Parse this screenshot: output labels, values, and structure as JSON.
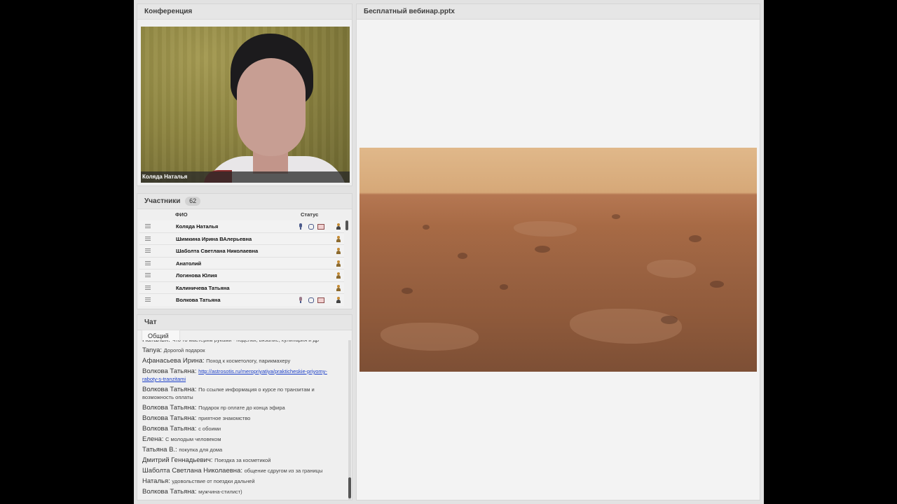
{
  "conference": {
    "title": "Конференция",
    "speaker_name": "Коляда Наталья"
  },
  "participants": {
    "title": "Участники",
    "count": "62",
    "col_name": "ФИО",
    "col_status": "Статус",
    "rows": [
      {
        "name": "Коляда Наталья",
        "mic": true,
        "mic_off": false,
        "cam": true,
        "screen": true,
        "role": "dark"
      },
      {
        "name": "Шимкина Ирина  ВАлерьевна",
        "mic": false,
        "cam": false,
        "screen": false,
        "role": "light"
      },
      {
        "name": "Шаболта Светлана  Николаевна",
        "mic": false,
        "cam": false,
        "screen": false,
        "role": "light"
      },
      {
        "name": "Анатолий",
        "mic": false,
        "cam": false,
        "screen": false,
        "role": "light"
      },
      {
        "name": "Логинова Юлия",
        "mic": false,
        "cam": false,
        "screen": false,
        "role": "light"
      },
      {
        "name": "Калиничева Татьяна",
        "mic": false,
        "cam": false,
        "screen": false,
        "role": "light"
      },
      {
        "name": "Волкова Татьяна",
        "mic": true,
        "mic_off": true,
        "cam": true,
        "screen": true,
        "role": "dark"
      }
    ]
  },
  "chat": {
    "title": "Чат",
    "tab": "Общий",
    "messages": [
      {
        "author": "Наталья:",
        "text": "Что то мастерим руками - поделки, вязание, кулинария и др",
        "link": ""
      },
      {
        "author": "Tanya:",
        "text": "Дорогой подарок",
        "link": ""
      },
      {
        "author": "Афанасьева Ирина:",
        "text": "Поход к косметологу, парикмахеру",
        "link": ""
      },
      {
        "author": "Волкова Татьяна:",
        "text": "",
        "link": "http://astrosotis.ru/meropriyatiya/prakticheskie-priyomy-raboty-s-tranzitami"
      },
      {
        "author": "Волкова Татьяна:",
        "text": "По ссылке информация о курсе по транзитам и возможность оплаты",
        "link": ""
      },
      {
        "author": "Волкова Татьяна:",
        "text": "Подарок пр оплате до конца эфира",
        "link": ""
      },
      {
        "author": "Волкова Татьяна:",
        "text": "приятное знакомство",
        "link": ""
      },
      {
        "author": "Волкова Татьяна:",
        "text": "с обоими",
        "link": ""
      },
      {
        "author": "Елена:",
        "text": "С молодым человеком",
        "link": ""
      },
      {
        "author": "Татьяна В.:",
        "text": "покупка для дома",
        "link": ""
      },
      {
        "author": "Дмитрий Геннадьевич:",
        "text": "Поездка за косметикой",
        "link": ""
      },
      {
        "author": "Шаболта Светлана  Николаевна:",
        "text": "общение сдругом из за границы",
        "link": ""
      },
      {
        "author": "Наталья:",
        "text": "удовольствие от поездки дальней",
        "link": ""
      },
      {
        "author": "Волкова Татьяна:",
        "text": "мужчина-стилист)",
        "link": ""
      }
    ]
  },
  "presentation": {
    "title": "Бесплатный вебинар.pptx"
  }
}
